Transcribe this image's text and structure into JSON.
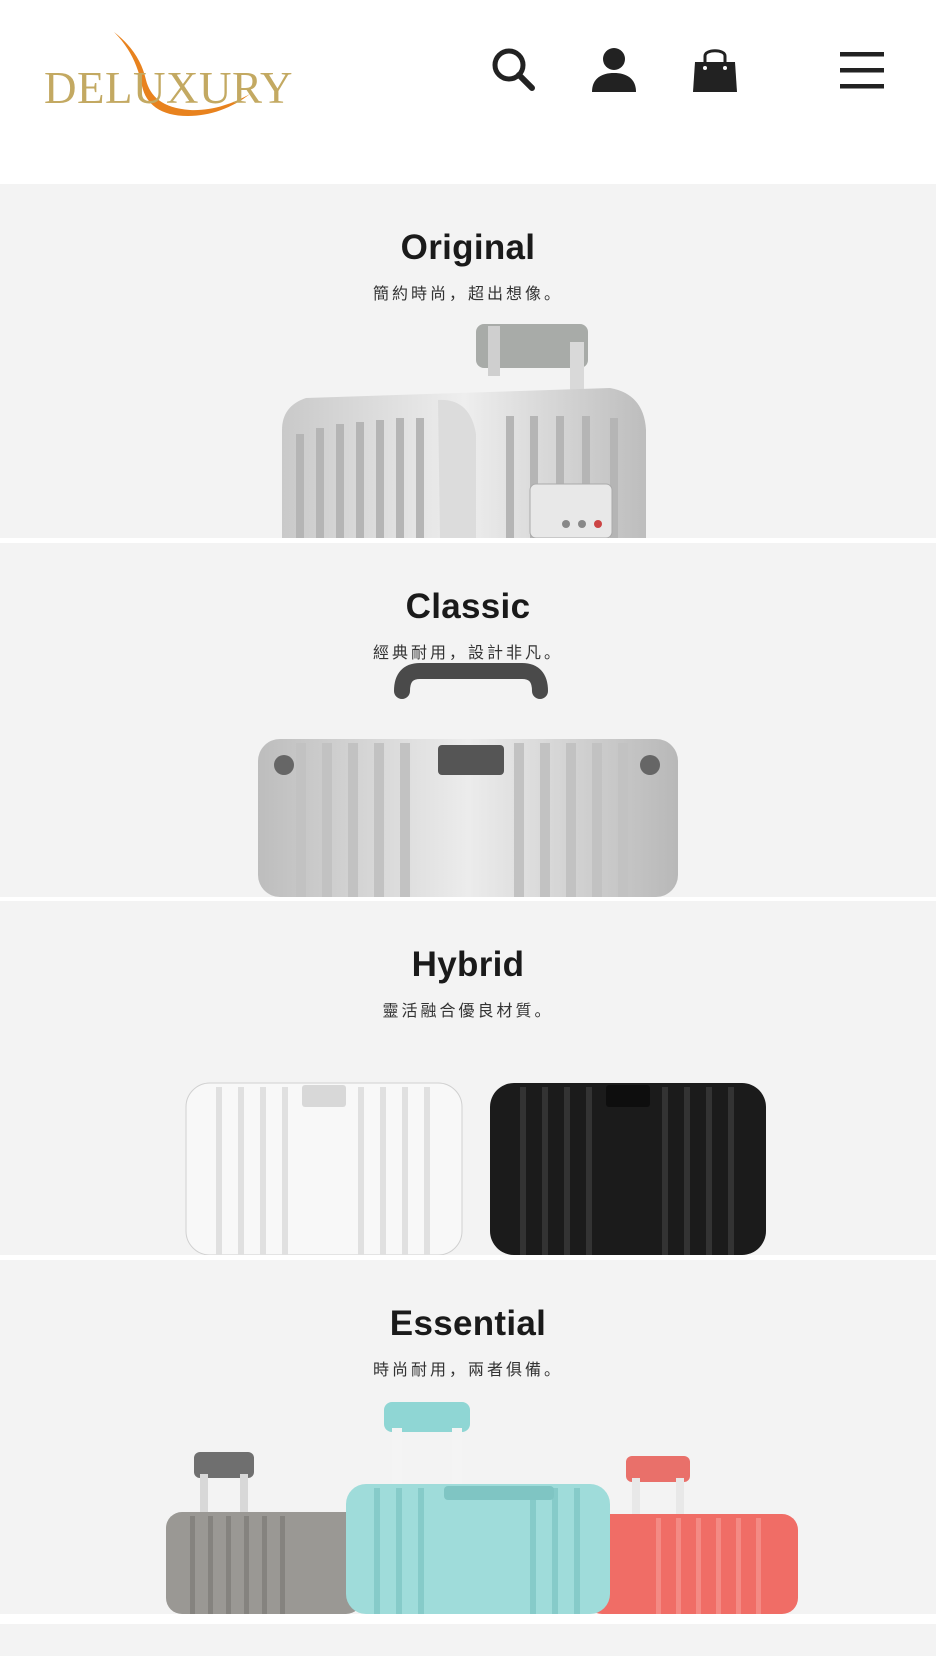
{
  "header": {
    "logo_text": "DELUXURY",
    "brand_colors": {
      "gold": "#c3a962",
      "orange": "#e8821e"
    },
    "icons": [
      "search-icon",
      "user-icon",
      "shopping-bag-icon",
      "menu-icon"
    ]
  },
  "collections": [
    {
      "title": "Original",
      "subtitle": "簡約時尚，超出想像。"
    },
    {
      "title": "Classic",
      "subtitle": "經典耐用，設計非凡。"
    },
    {
      "title": "Hybrid",
      "subtitle": "靈活融合優良材質。"
    },
    {
      "title": "Essential",
      "subtitle": "時尚耐用，兩者俱備。"
    }
  ],
  "colors": {
    "panel_bg": "#f3f3f3",
    "text": "#1a1a1a"
  }
}
